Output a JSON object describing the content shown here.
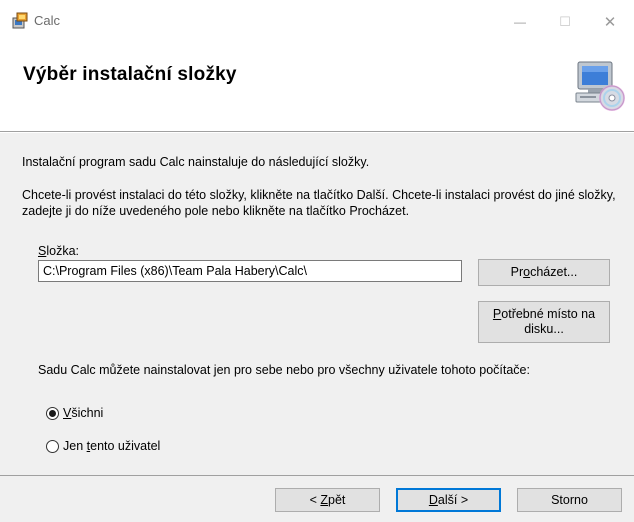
{
  "window": {
    "title": "Calc",
    "minimize_glyph": "—",
    "maximize_glyph": "☐",
    "close_glyph": "✕"
  },
  "header": {
    "title": "Výběr instalační složky",
    "art_icon": "computer-cd-icon"
  },
  "body": {
    "intro": "Instalační program sadu Calc nainstaluje do následující složky.",
    "description": "Chcete-li provést instalaci do této složky, klikněte na tlačítko Další. Chcete-li instalaci provést do jiné složky, zadejte ji do níže uvedeného pole nebo klikněte na tlačítko Procházet.",
    "folder_label_mnemonic": "S",
    "folder_label_rest": "ložka:",
    "folder_path": "C:\\Program Files (x86)\\Team Pala Habery\\Calc\\",
    "browse_pre": "Pr",
    "browse_mnemonic": "o",
    "browse_post": "cházet...",
    "space_mnemonic": "P",
    "space_rest": "otřebné místo na disku...",
    "install_for": "Sadu Calc můžete nainstalovat jen pro sebe nebo pro všechny uživatele tohoto počítače:",
    "radio_all_mnemonic": "V",
    "radio_all_rest": "šichni",
    "radio_me_pre": "Jen ",
    "radio_me_mnemonic": "t",
    "radio_me_post": "ento uživatel",
    "selected_option": "all"
  },
  "footer": {
    "back_pre": "< ",
    "back_mnemonic": "Z",
    "back_post": "pět",
    "next_mnemonic": "D",
    "next_post": "alší >",
    "cancel": "Storno"
  },
  "colors": {
    "accent": "#0078d7",
    "panel": "#f0f0f0",
    "button": "#e1e1e1"
  }
}
